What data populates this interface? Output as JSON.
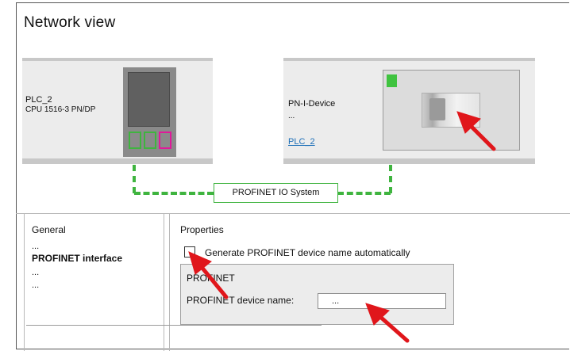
{
  "view": {
    "title": "Network view"
  },
  "plc": {
    "name": "PLC_2",
    "type": "CPU 1516-3 PN/DP"
  },
  "io_device": {
    "name": "PN-I-Device",
    "ellipsis": "...",
    "assigned_plc_link": "PLC_2"
  },
  "network": {
    "label": "PROFINET IO System",
    "color": "#3fb43f"
  },
  "navigation": {
    "header": "General",
    "items": [
      "...",
      "PROFINET interface",
      "...",
      "..."
    ],
    "selected": "PROFINET interface"
  },
  "properties": {
    "header": "Properties",
    "auto_name_checkbox": {
      "label": "Generate PROFINET device name automatically",
      "checked": false
    },
    "profinet_group": {
      "title": "PROFINET",
      "device_name_label": "PROFINET device name:",
      "device_name_value": "..."
    }
  },
  "annotations": {
    "arrow_color": "#e0161b",
    "arrow_icon": "red-pointer-arrow"
  }
}
